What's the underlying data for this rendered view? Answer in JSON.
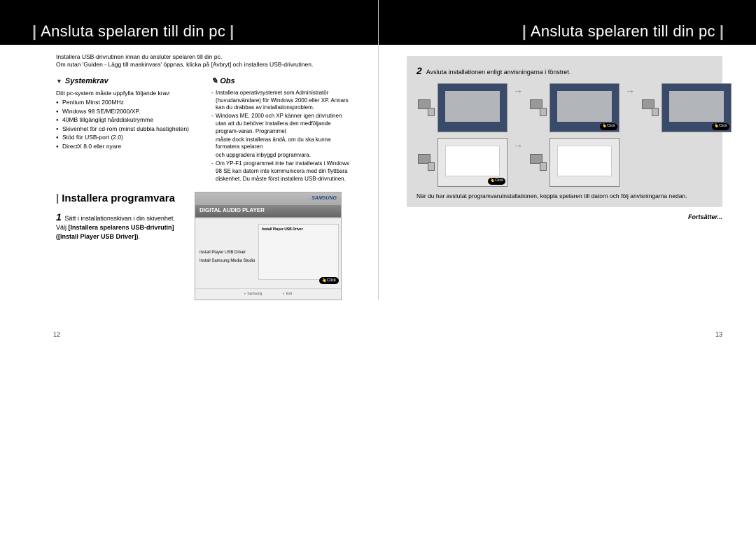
{
  "leftPage": {
    "bandTitle": "Ansluta spelaren till din pc",
    "intro1": "Installera USB-drivrutinen innan du ansluter spelaren till din pc.",
    "intro2": "Om rutan 'Guiden - Lägg till maskinvara' öppnas, klicka på [Avbryt] och installera USB-drivrutinen.",
    "systemkrav": {
      "heading": "Systemkrav",
      "lead": "Ditt pc-system måste uppfylla följande krav:",
      "items": [
        "Pentium Minst 200MHz",
        "Windows 98 SE/ME/2000/XP.",
        "40MB tillgängligt hårddiskutrymme",
        "Skivenhet för cd-rom (minst dubbla hastigheten)",
        "Stöd för USB-port (2.0)",
        "DirectX 8.0 eller nyare"
      ]
    },
    "obs": {
      "heading": "Obs",
      "lines": [
        {
          "dash": true,
          "text": "Installera operativsystemet som Administratör (huvudanvändare) för Windows 2000 eller XP. Annars kan du drabbas av installationsproblem."
        },
        {
          "dash": true,
          "text": "Windows ME, 2000 och XP känner igen drivrutinen utan att du behöver installera den medföljande program-varan. Programmet"
        },
        {
          "dash": false,
          "text": "måste dock installeras ändå, om du ska kunna formatera spelaren"
        },
        {
          "dash": false,
          "text": "och uppgradera inbyggd programvara."
        },
        {
          "dash": true,
          "text": "Om YP-F1 programmet inte har installerats i Windows 98 SE kan datorn inte kommunicera med din flyttbara diskenhet. Du måste först installera USB-drivrutinen."
        }
      ]
    },
    "install": {
      "title": "Installera programvara",
      "stepNum": "1",
      "stepText1": "Sätt i installationsskivan i din skivenhet.",
      "stepText2a": "Välj ",
      "stepText2b": "[Installera spelarens USB-drivrutin] ([Install Player USB Driver])",
      "stepText2c": "."
    },
    "installer": {
      "brand": "SAMSUNG",
      "header": "DIGITAL AUDIO PLAYER",
      "dialogTitle": "Install Player USB Driver",
      "leftItem1": "Install Player USB Driver",
      "leftItem2": "Install Samsung Media Studio",
      "click": "Click",
      "footerLeft": "Samsung",
      "footerRight": "Exit"
    },
    "pageNum": "12"
  },
  "rightPage": {
    "bandTitle": "Ansluta spelaren till din pc",
    "stepNum": "2",
    "stepText": "Avsluta installationen enligt anvisningarna i fönstret.",
    "clickLabel": "Click",
    "postText": "När du har avslutat programvaruinstallationen, koppla spelaren till datorn och följ anvisningarna nedan.",
    "continue": "Fortsätter...",
    "pageNum": "13"
  }
}
